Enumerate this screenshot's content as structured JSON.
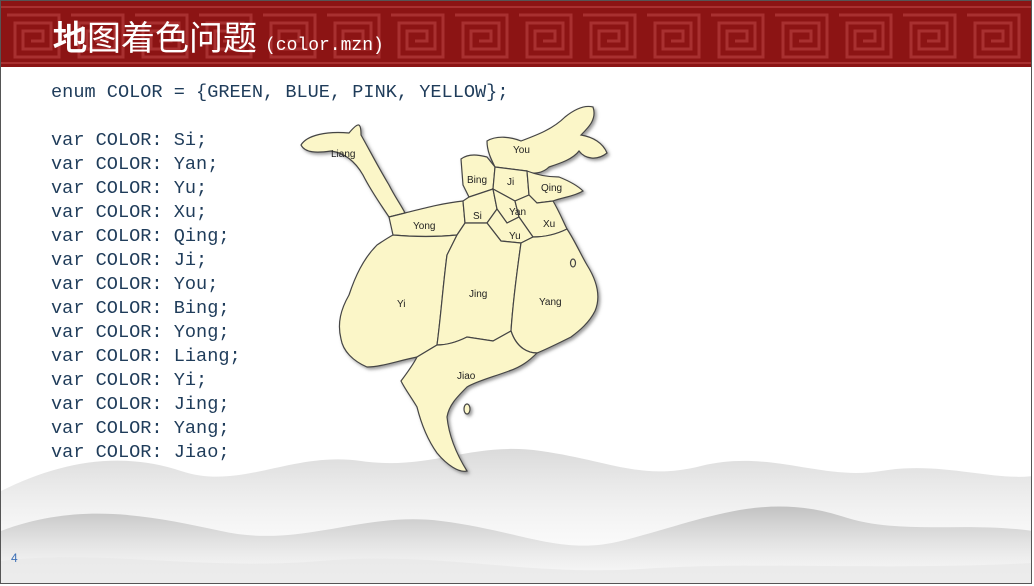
{
  "slide": {
    "title_bold": "地",
    "title_rest": "图着色问题",
    "title_file": "(color.mzn)",
    "page_number": "4"
  },
  "code": {
    "enum_line": "enum COLOR = {GREEN, BLUE, PINK, YELLOW};",
    "var_lines": [
      "var COLOR: Si;",
      "var COLOR: Yan;",
      "var COLOR: Yu;",
      "var COLOR: Xu;",
      "var COLOR: Qing;",
      "var COLOR: Ji;",
      "var COLOR: You;",
      "var COLOR: Bing;",
      "var COLOR: Yong;",
      "var COLOR: Liang;",
      "var COLOR: Yi;",
      "var COLOR: Jing;",
      "var COLOR: Yang;",
      "var COLOR: Jiao;"
    ]
  },
  "map": {
    "fill_color": "#fbf6c8",
    "regions": {
      "liang": "Liang",
      "you": "You",
      "bing": "Bing",
      "ji": "Ji",
      "qing": "Qing",
      "yong": "Yong",
      "si": "Si",
      "yan": "Yan",
      "xu": "Xu",
      "yu": "Yu",
      "yi": "Yi",
      "jing": "Jing",
      "yang": "Yang",
      "jiao": "Jiao"
    }
  },
  "colors": {
    "banner": "#8c1414",
    "code_text": "#1f3c5a",
    "page_number": "#3b6fb6"
  }
}
